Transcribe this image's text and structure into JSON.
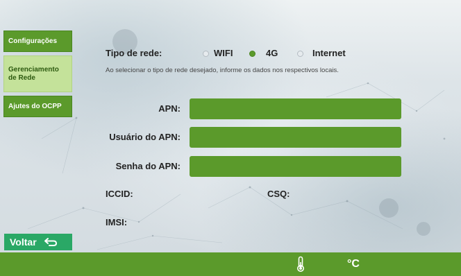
{
  "sidebar": {
    "items": [
      {
        "label": "Configurações",
        "active": false
      },
      {
        "label": "Gerenciamento de Rede",
        "active": true
      },
      {
        "label": "Ajutes do OCPP",
        "active": false
      }
    ]
  },
  "network": {
    "type_label": "Tipo de rede:",
    "options": [
      {
        "label": "WIFI",
        "selected": false
      },
      {
        "label": "4G",
        "selected": true
      },
      {
        "label": "Internet",
        "selected": false
      }
    ],
    "hint": "Ao selecionar o tipo de rede desejado, informe os dados nos respectivos locais."
  },
  "form": {
    "apn_label": "APN:",
    "apn_value": "",
    "user_label": "Usuário do APN:",
    "user_value": "",
    "password_label": "Senha do APN:",
    "password_value": "",
    "iccid_label": "ICCID:",
    "csq_label": "CSQ:",
    "imsi_label": "IMSI:"
  },
  "footer": {
    "back_label": "Voltar",
    "temp_unit": "°C"
  },
  "colors": {
    "accent_green": "#5b9a2b",
    "active_tab": "#c4e29a",
    "back_button": "#2aa866"
  }
}
